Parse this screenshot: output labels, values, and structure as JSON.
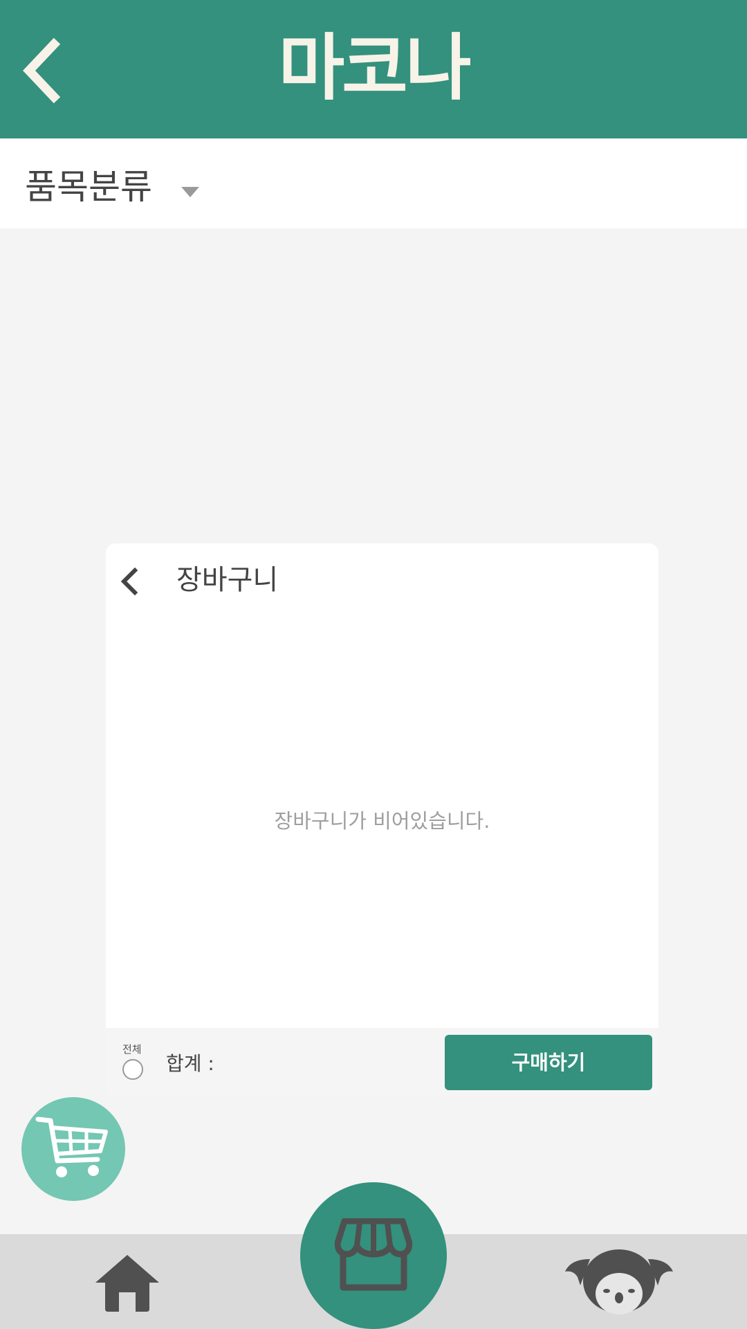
{
  "app": {
    "title": "마코나"
  },
  "category": {
    "label": "품목분류"
  },
  "cart": {
    "title": "장바구니",
    "empty_message": "장바구니가 비어있습니다.",
    "select_all_label": "전체",
    "total_label": "합계 :",
    "buy_label": "구매하기"
  },
  "colors": {
    "primary": "#33917d",
    "cart_fab": "#74c7b2",
    "nav_background": "#dadada",
    "page_background": "#f4f4f4"
  },
  "icons": {
    "header_back": "chevron-left-icon",
    "category_dropdown": "caret-down-icon",
    "cart_back": "chevron-left-icon",
    "cart_fab": "shopping-cart-icon",
    "nav_home": "home-icon",
    "nav_store": "store-icon",
    "nav_profile": "koala-icon"
  }
}
